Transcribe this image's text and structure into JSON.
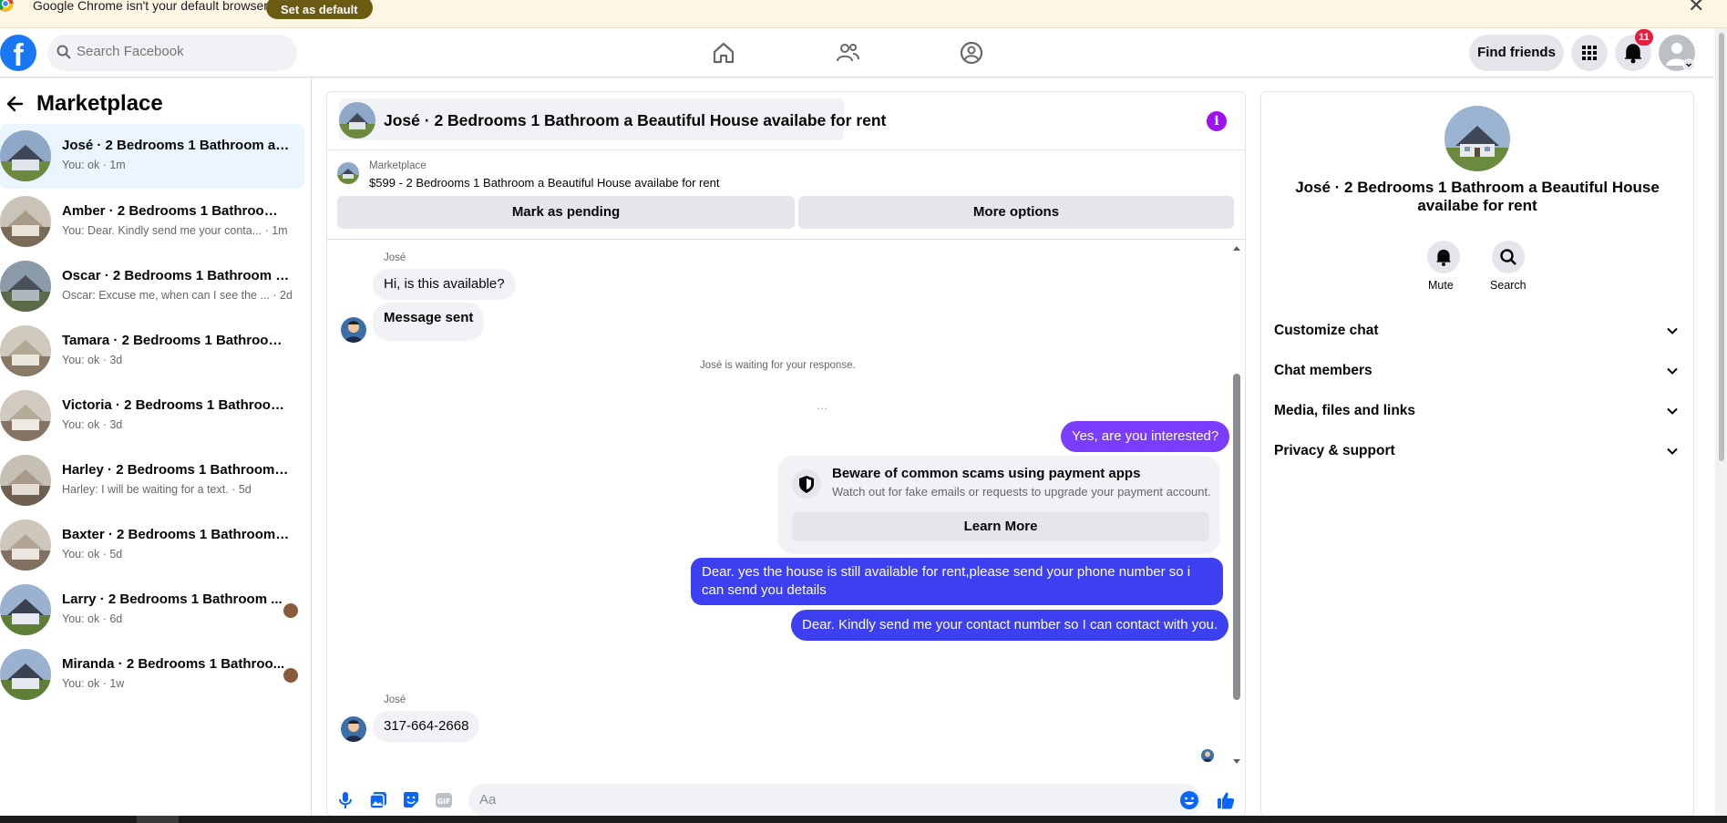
{
  "infobar": {
    "text": "Google Chrome isn't your default browser",
    "button": "Set as default"
  },
  "header": {
    "search_placeholder": "Search Facebook",
    "find_friends": "Find friends",
    "notification_count": "11"
  },
  "sidebar": {
    "title": "Marketplace",
    "conversations": [
      {
        "name": "José · 2 Bedrooms 1 Bathroom a B...",
        "preview": "You: ok · 1m",
        "active": true
      },
      {
        "name": "Amber · 2 Bedrooms 1 Bathroom a...",
        "preview": "You: Dear. Kindly send me your conta... · 1m"
      },
      {
        "name": "Oscar · 2 Bedrooms 1 Bathroom a ...",
        "preview": "Oscar: Excuse me, when can I see the ... · 2d"
      },
      {
        "name": "Tamara · 2 Bedrooms 1 Bathroom ...",
        "preview": "You: ok · 3d"
      },
      {
        "name": "Victoria · 2 Bedrooms 1 Bathroom ...",
        "preview": "You: ok · 3d"
      },
      {
        "name": "Harley · 2 Bedrooms 1 Bathroom a ...",
        "preview": "Harley: I will be waiting for a text. · 5d"
      },
      {
        "name": "Baxter · 2 Bedrooms 1 Bathroom a ...",
        "preview": "You: ok · 5d"
      },
      {
        "name": "Larry · 2 Bedrooms 1 Bathroom ...",
        "preview": "You: ok · 6d"
      },
      {
        "name": "Miranda · 2 Bedrooms 1 Bathroo...",
        "preview": "You: ok · 1w"
      }
    ]
  },
  "chat": {
    "title": "José · 2 Bedrooms 1 Bathroom a Beautiful House availabe for rent",
    "listing_label": "Marketplace",
    "listing_desc": "$599 - 2 Bedrooms 1 Bathroom a Beautiful House availabe for rent",
    "mark_pending": "Mark as pending",
    "more_options": "More options",
    "sender_1": "José",
    "msg_1": "Hi, is this available?",
    "msg_2": "Message sent",
    "waiting": "José is waiting for your response.",
    "msg_out_1": "Yes, are you interested?",
    "scam_title": "Beware of common scams using payment apps",
    "scam_sub": "Watch out for fake emails or requests to upgrade your payment account.",
    "learn_more": "Learn More",
    "msg_out_2": "Dear. yes the house is still available for rent,please send your  phone number so i can send you details",
    "msg_out_3": "Dear. Kindly send me your contact number so I can contact with you.",
    "sender_2": "José",
    "msg_3": "317-664-2668",
    "composer_placeholder": "Aa"
  },
  "details": {
    "title": "José · 2 Bedrooms 1 Bathroom a Beautiful House availabe for rent",
    "mute": "Mute",
    "search": "Search",
    "rows": [
      "Customize chat",
      "Chat members",
      "Media, files and links",
      "Privacy & support"
    ]
  },
  "colors": {
    "brand": "#1877f2",
    "outgoing": "#3d40f0",
    "outgoing_purple": "#7a3dff",
    "info": "#a010f0"
  }
}
